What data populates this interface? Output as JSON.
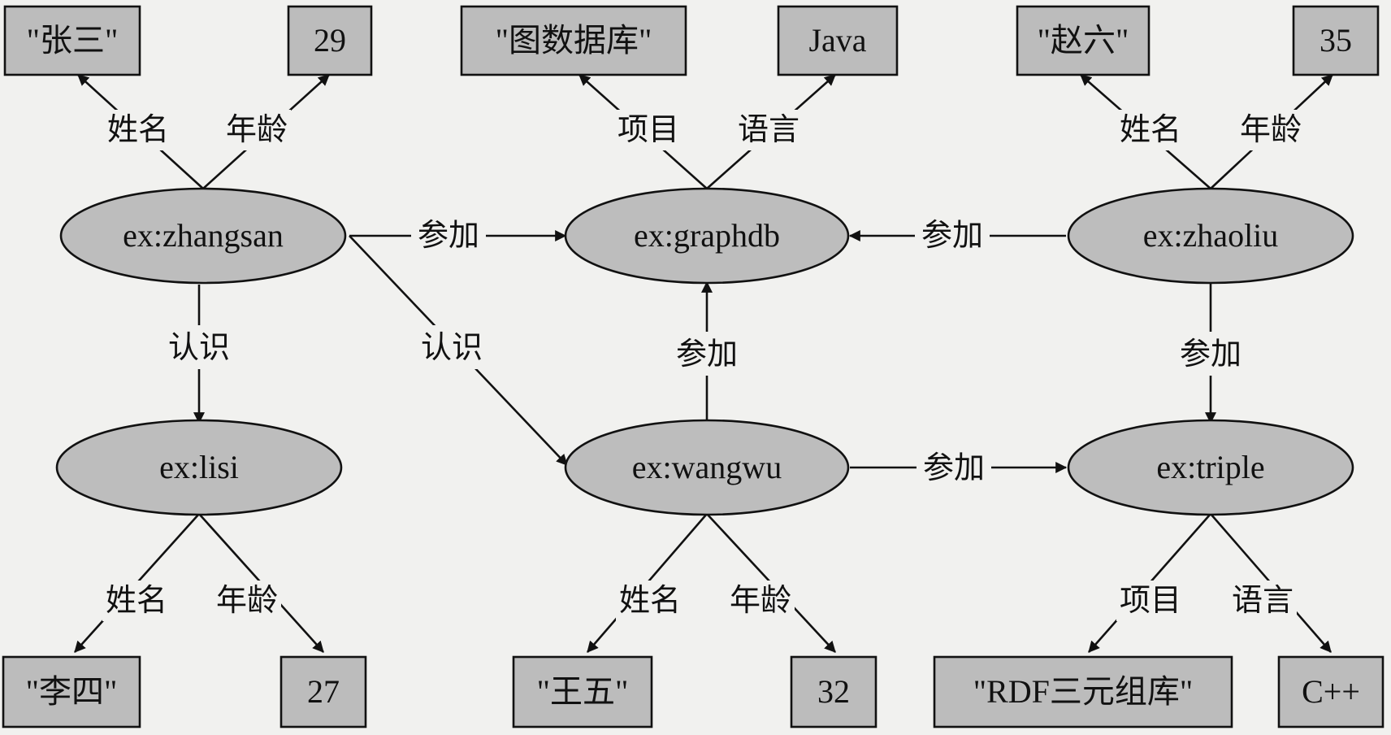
{
  "nodes": {
    "zhangsan": "ex:zhangsan",
    "graphdb": "ex:graphdb",
    "zhaoliu": "ex:zhaoliu",
    "lisi": "ex:lisi",
    "wangwu": "ex:wangwu",
    "triple": "ex:triple"
  },
  "literals": {
    "zhangsan_name": "\"张三\"",
    "zhangsan_age": "29",
    "graphdb_project": "\"图数据库\"",
    "graphdb_lang": "Java",
    "zhaoliu_name": "\"赵六\"",
    "zhaoliu_age": "35",
    "lisi_name": "\"李四\"",
    "lisi_age": "27",
    "wangwu_name": "\"王五\"",
    "wangwu_age": "32",
    "triple_project": "\"RDF三元组库\"",
    "triple_lang": "C++"
  },
  "edge_labels": {
    "zhangsan_name": "姓名",
    "zhangsan_age": "年龄",
    "graphdb_project": "项目",
    "graphdb_lang": "语言",
    "zhaoliu_name": "姓名",
    "zhaoliu_age": "年龄",
    "zhangsan_graphdb": "参加",
    "zhaoliu_graphdb": "参加",
    "zhangsan_lisi": "认识",
    "zhangsan_wangwu": "认识",
    "wangwu_graphdb": "参加",
    "zhaoliu_triple": "参加",
    "wangwu_triple": "参加",
    "lisi_name": "姓名",
    "lisi_age": "年龄",
    "wangwu_name": "姓名",
    "wangwu_age": "年龄",
    "triple_project": "项目",
    "triple_lang": "语言"
  },
  "colors": {
    "node_fill": "#bdbdbd",
    "literal_fill": "#bcbcbc",
    "stroke": "#111111",
    "background": "#f1f1ef"
  }
}
